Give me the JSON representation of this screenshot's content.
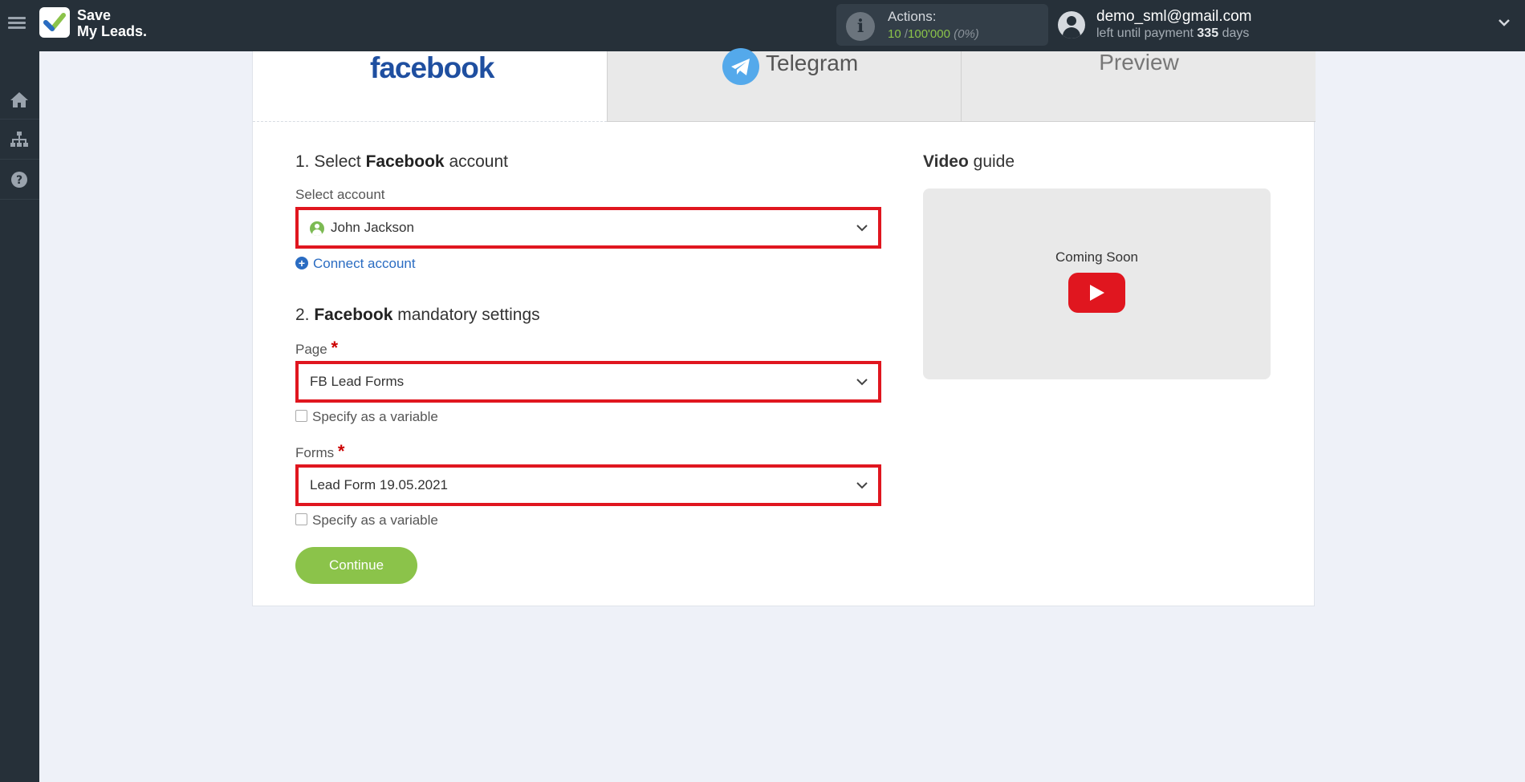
{
  "brand": {
    "line1": "Save",
    "line2": "My Leads."
  },
  "actions": {
    "label": "Actions:",
    "used": "10",
    "separator": " /",
    "total": "100'000",
    "percent": "(0%)"
  },
  "user": {
    "email": "demo_sml@gmail.com",
    "days_prefix": "left until payment",
    "days_value": "335",
    "days_suffix": "days"
  },
  "sidebar": {
    "items": [
      "home-icon",
      "sitemap-icon",
      "help-icon"
    ]
  },
  "tabs": {
    "source": "facebook",
    "destination": "Telegram",
    "preview": "Preview"
  },
  "section1": {
    "num": "1. Select",
    "bold": "Facebook",
    "rest": "account"
  },
  "account": {
    "label": "Select account",
    "value": "John Jackson",
    "connect": "Connect account"
  },
  "section2": {
    "num": "2.",
    "bold": "Facebook",
    "rest": "mandatory settings"
  },
  "page_field": {
    "label": "Page",
    "required": "*",
    "value": "FB Lead Forms",
    "variable": "Specify as a variable"
  },
  "forms_field": {
    "label": "Forms",
    "required": "*",
    "value": "Lead Form 19.05.2021",
    "variable": "Specify as a variable"
  },
  "continue_label": "Continue",
  "video": {
    "title_bold": "Video",
    "title_rest": "guide",
    "text": "Coming Soon"
  },
  "colors": {
    "accent_red": "#e0161f",
    "green": "#8bc34a",
    "link": "#2a6cc2",
    "topbar": "#263039"
  }
}
